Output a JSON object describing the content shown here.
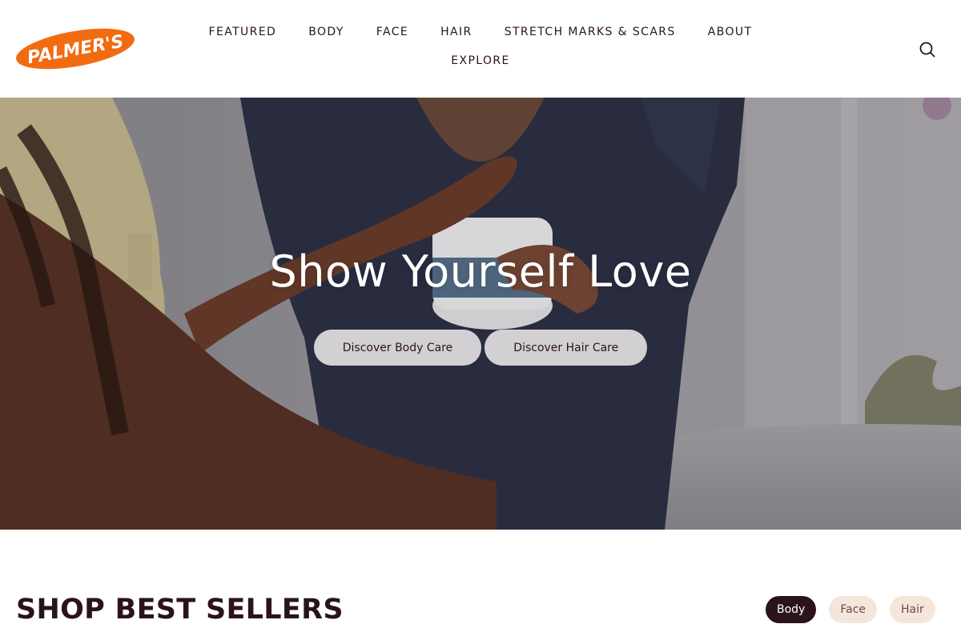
{
  "brand": {
    "logo_text": "PALMER'S",
    "logo_color": "#f36b10"
  },
  "nav": {
    "row1": [
      "FEATURED",
      "BODY",
      "FACE",
      "HAIR",
      "STRETCH MARKS & SCARS",
      "ABOUT"
    ],
    "row2": [
      "EXPLORE"
    ],
    "search_icon": "search-icon"
  },
  "hero": {
    "title": "Show Yourself Love",
    "buttons": [
      "Discover Body Care",
      "Discover Hair Care"
    ]
  },
  "best_sellers": {
    "title": "SHOP BEST SELLERS",
    "tabs": [
      {
        "label": "Body",
        "active": true
      },
      {
        "label": "Face",
        "active": false
      },
      {
        "label": "Hair",
        "active": false
      }
    ]
  },
  "colors": {
    "text": "#2a1419",
    "pill_inactive": "#f5e6dc",
    "accent": "#f36b10"
  }
}
